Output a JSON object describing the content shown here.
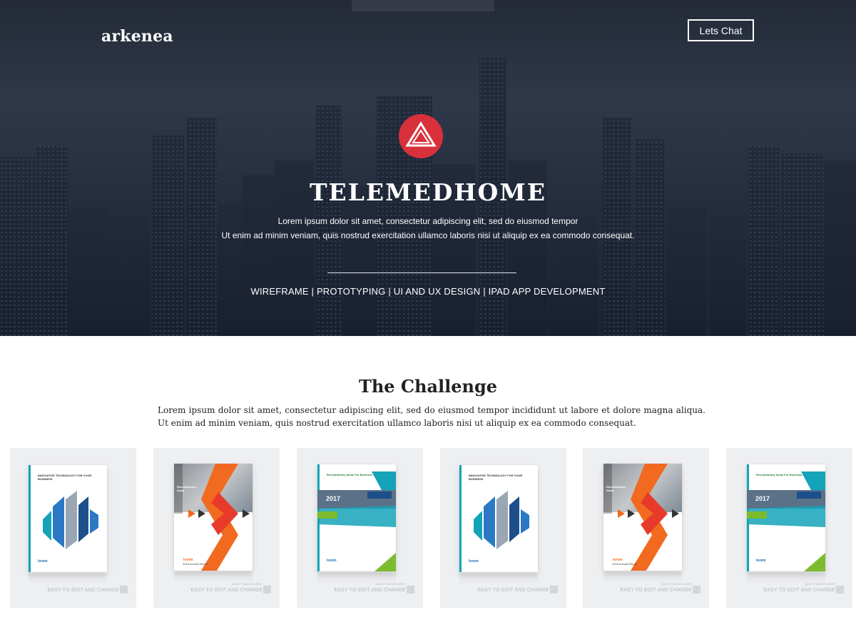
{
  "header": {
    "logo": "arkenea",
    "cta_label": "Lets Chat"
  },
  "hero": {
    "icon": "triangle-logo-icon",
    "title": "TELEMEDHOME",
    "subtitle_line1": "Lorem ipsum dolor sit amet, consectetur adipiscing elit, sed do eiusmod tempor",
    "subtitle_line2": "Ut enim ad minim veniam, quis nostrud exercitation ullamco laboris nisi ut aliquip ex ea commodo consequat.",
    "services": "WIREFRAME | PROTOTYPING | UI AND UX DESIGN | IPAD APP DEVELOPMENT"
  },
  "challenge": {
    "title": "The Challenge",
    "body": "Lorem ipsum dolor sit amet, consectetur adipiscing elit, sed do eiusmod tempor incididunt ut labore et dolore magna aliqua. Ut enim ad minim veniam, quis nostrud exercitation ullamco laboris nisi ut aliquip ex ea commodo consequat."
  },
  "cards": [
    {
      "style": "blue-arrows",
      "tagline": "INNOVATIVE TECHNOLOGY FOR YOUR BUSINESS",
      "brand": "lorem",
      "caption_small": "",
      "caption": "EASY TO EDIT AND CHANGE"
    },
    {
      "style": "orange-arrow",
      "tagline": "Revolutionary Ideas",
      "brand": "lorem",
      "report": "2016 Annual Report",
      "caption_small": "QUALITY AND ACCURATE",
      "caption": "EASY TO EDIT AND CHANGE"
    },
    {
      "style": "teal-green",
      "tagline": "Revolutionary Ideas For Business",
      "year": "2017",
      "brand": "lorem",
      "caption_small": "QUALITY AND ACCURATE",
      "caption": "EASY TO EDIT AND CHANGE"
    },
    {
      "style": "blue-arrows",
      "tagline": "INNOVATIVE TECHNOLOGY FOR YOUR BUSINESS",
      "brand": "lorem",
      "caption_small": "",
      "caption": "EASY TO EDIT AND CHANGE"
    },
    {
      "style": "orange-arrow",
      "tagline": "Revolutionary Ideas",
      "brand": "lorem",
      "report": "2016 Annual Report",
      "caption_small": "QUALITY AND ACCURATE",
      "caption": "EASY TO EDIT AND CHANGE"
    },
    {
      "style": "teal-green",
      "tagline": "Revolutionary Ideas For Business",
      "year": "2017",
      "brand": "lorem",
      "caption_small": "QUALITY AND ACCURATE",
      "caption": "EASY TO EDIT AND CHANGE"
    }
  ],
  "colors": {
    "accent_red": "#d8313c",
    "hero_dark": "#2c3646",
    "card_bg": "#eeeff1",
    "teal": "#14a3b8",
    "orange": "#f26a1f",
    "green": "#7dbb2e",
    "navy": "#1d4f8a"
  }
}
